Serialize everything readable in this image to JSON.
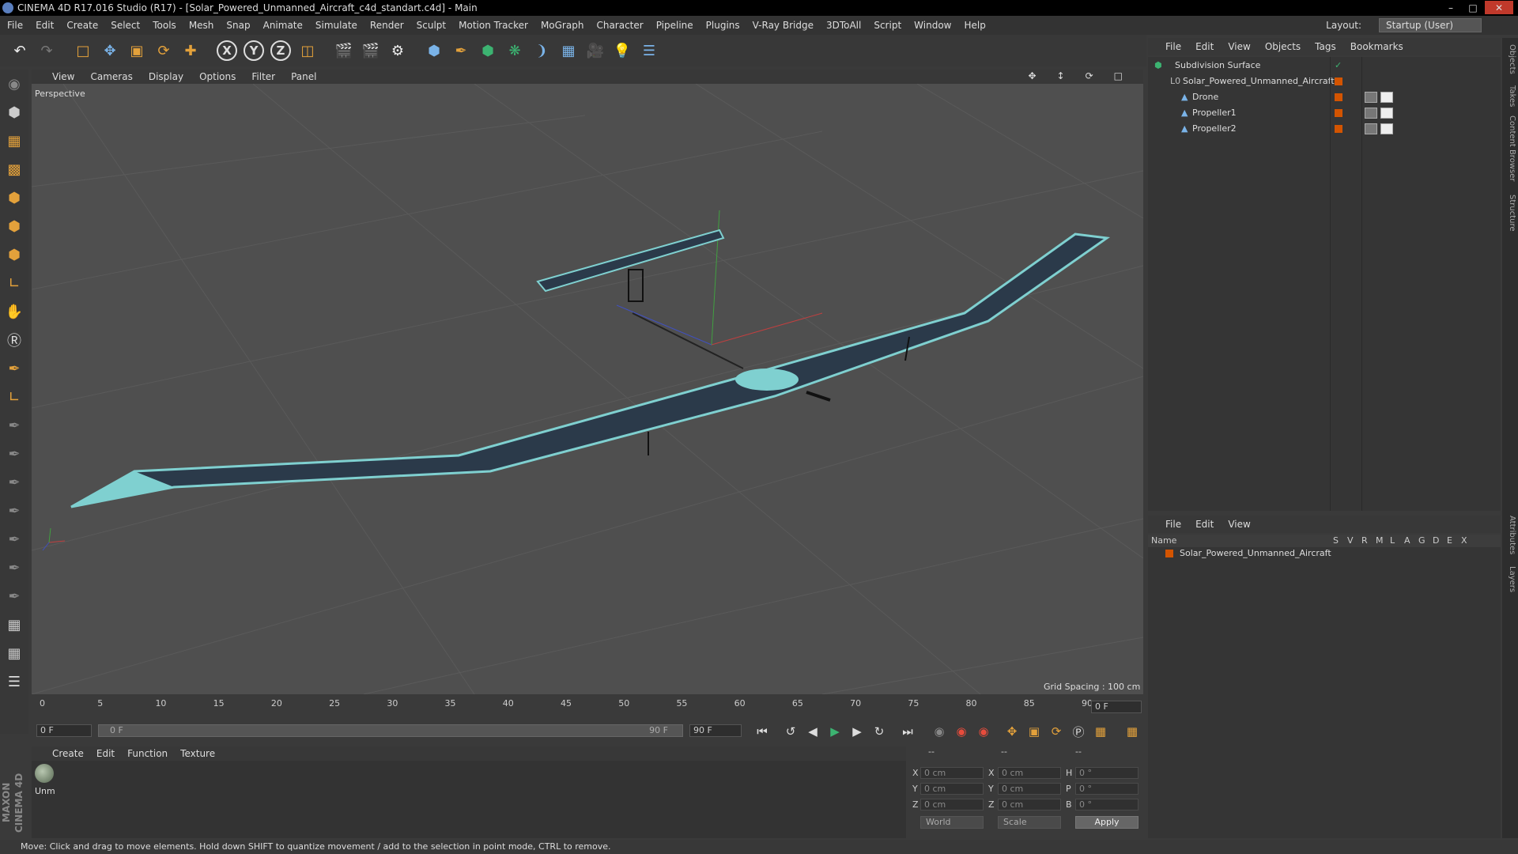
{
  "window": {
    "title": "CINEMA 4D R17.016 Studio (R17) - [Solar_Powered_Unmanned_Aircraft_c4d_standart.c4d] - Main"
  },
  "menu": [
    "File",
    "Edit",
    "Create",
    "Select",
    "Tools",
    "Mesh",
    "Snap",
    "Animate",
    "Simulate",
    "Render",
    "Sculpt",
    "Motion Tracker",
    "MoGraph",
    "Character",
    "Pipeline",
    "Plugins",
    "V-Ray Bridge",
    "3DToAll",
    "Script",
    "Window",
    "Help"
  ],
  "layout": {
    "label": "Layout:",
    "value": "Startup (User)"
  },
  "toolbar": {
    "axis_x": "X",
    "axis_y": "Y",
    "axis_z": "Z"
  },
  "viewport": {
    "menu": [
      "View",
      "Cameras",
      "Display",
      "Options",
      "Filter",
      "Panel"
    ],
    "label": "Perspective",
    "grid_spacing": "Grid Spacing : 100 cm"
  },
  "timeline": {
    "ticks": [
      "0",
      "5",
      "10",
      "15",
      "20",
      "25",
      "30",
      "35",
      "40",
      "45",
      "50",
      "55",
      "60",
      "65",
      "70",
      "75",
      "80",
      "85",
      "90"
    ],
    "frame_right": "0 F",
    "start_field": "0 F",
    "slider_start": "0 F",
    "slider_end": "90 F",
    "end_field": "90 F"
  },
  "materials": {
    "menu": [
      "Create",
      "Edit",
      "Function",
      "Texture"
    ],
    "items": [
      {
        "name": "Unm"
      }
    ]
  },
  "coords": {
    "headers": [
      "--",
      "--",
      "--"
    ],
    "rows": [
      {
        "l1": "X",
        "v1": "0 cm",
        "l2": "X",
        "v2": "0 cm",
        "l3": "H",
        "v3": "0 °"
      },
      {
        "l1": "Y",
        "v1": "0 cm",
        "l2": "Y",
        "v2": "0 cm",
        "l3": "P",
        "v3": "0 °"
      },
      {
        "l1": "Z",
        "v1": "0 cm",
        "l2": "Z",
        "v2": "0 cm",
        "l3": "B",
        "v3": "0 °"
      }
    ],
    "mode": "World",
    "scale": "Scale",
    "apply": "Apply"
  },
  "objects": {
    "menu": [
      "File",
      "Edit",
      "View",
      "Objects",
      "Tags",
      "Bookmarks"
    ],
    "tree": [
      {
        "name": "Subdivision Surface",
        "indent": 0
      },
      {
        "name": "Solar_Powered_Unmanned_Aircraft",
        "indent": 1
      },
      {
        "name": "Drone",
        "indent": 2
      },
      {
        "name": "Propeller1",
        "indent": 2
      },
      {
        "name": "Propeller2",
        "indent": 2
      }
    ]
  },
  "layers": {
    "menu": [
      "File",
      "Edit",
      "View"
    ],
    "headers": [
      "Name",
      "S",
      "V",
      "R",
      "M",
      "L",
      "A",
      "G",
      "D",
      "E",
      "X"
    ],
    "rows": [
      {
        "name": "Solar_Powered_Unmanned_Aircraft",
        "color": "#d35400"
      }
    ]
  },
  "sidetabs": [
    "Objects",
    "Takes",
    "Content Browser",
    "Structure",
    "Attributes",
    "Layers"
  ],
  "status": "Move: Click and drag to move elements. Hold down SHIFT to quantize movement / add to the selection in point mode, CTRL to remove.",
  "maxon": "MAXON CINEMA 4D"
}
